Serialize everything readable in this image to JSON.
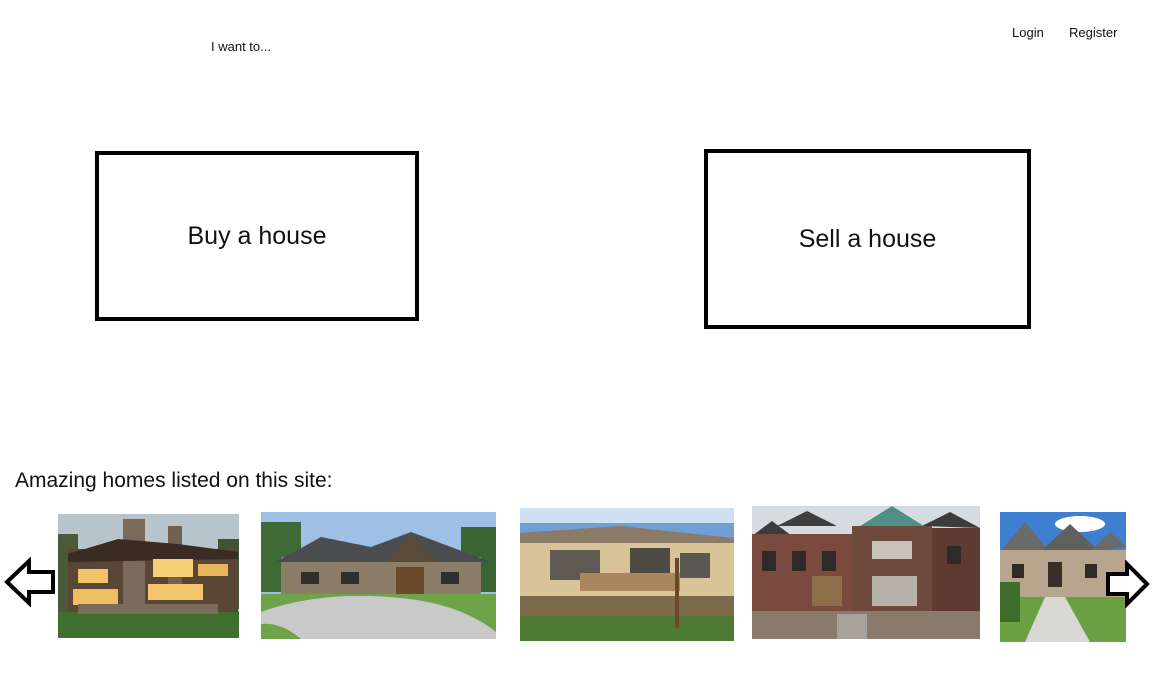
{
  "intro": {
    "text": "I want to..."
  },
  "nav": {
    "login_label": "Login",
    "register_label": "Register"
  },
  "actions": {
    "buy_label": "Buy a house",
    "sell_label": "Sell a house"
  },
  "listings": {
    "heading": "Amazing homes listed on this site:",
    "prev_icon": "arrow-left-icon",
    "next_icon": "arrow-right-icon",
    "photos": [
      {
        "subject": "luxury stone and timber lodge lit at dusk"
      },
      {
        "subject": "craftsman stone house with curved driveway"
      },
      {
        "subject": "tan single-story house with dirt yard"
      },
      {
        "subject": "old brick victorian house with boarded windows"
      },
      {
        "subject": "stone suburban house with walkway"
      }
    ]
  }
}
